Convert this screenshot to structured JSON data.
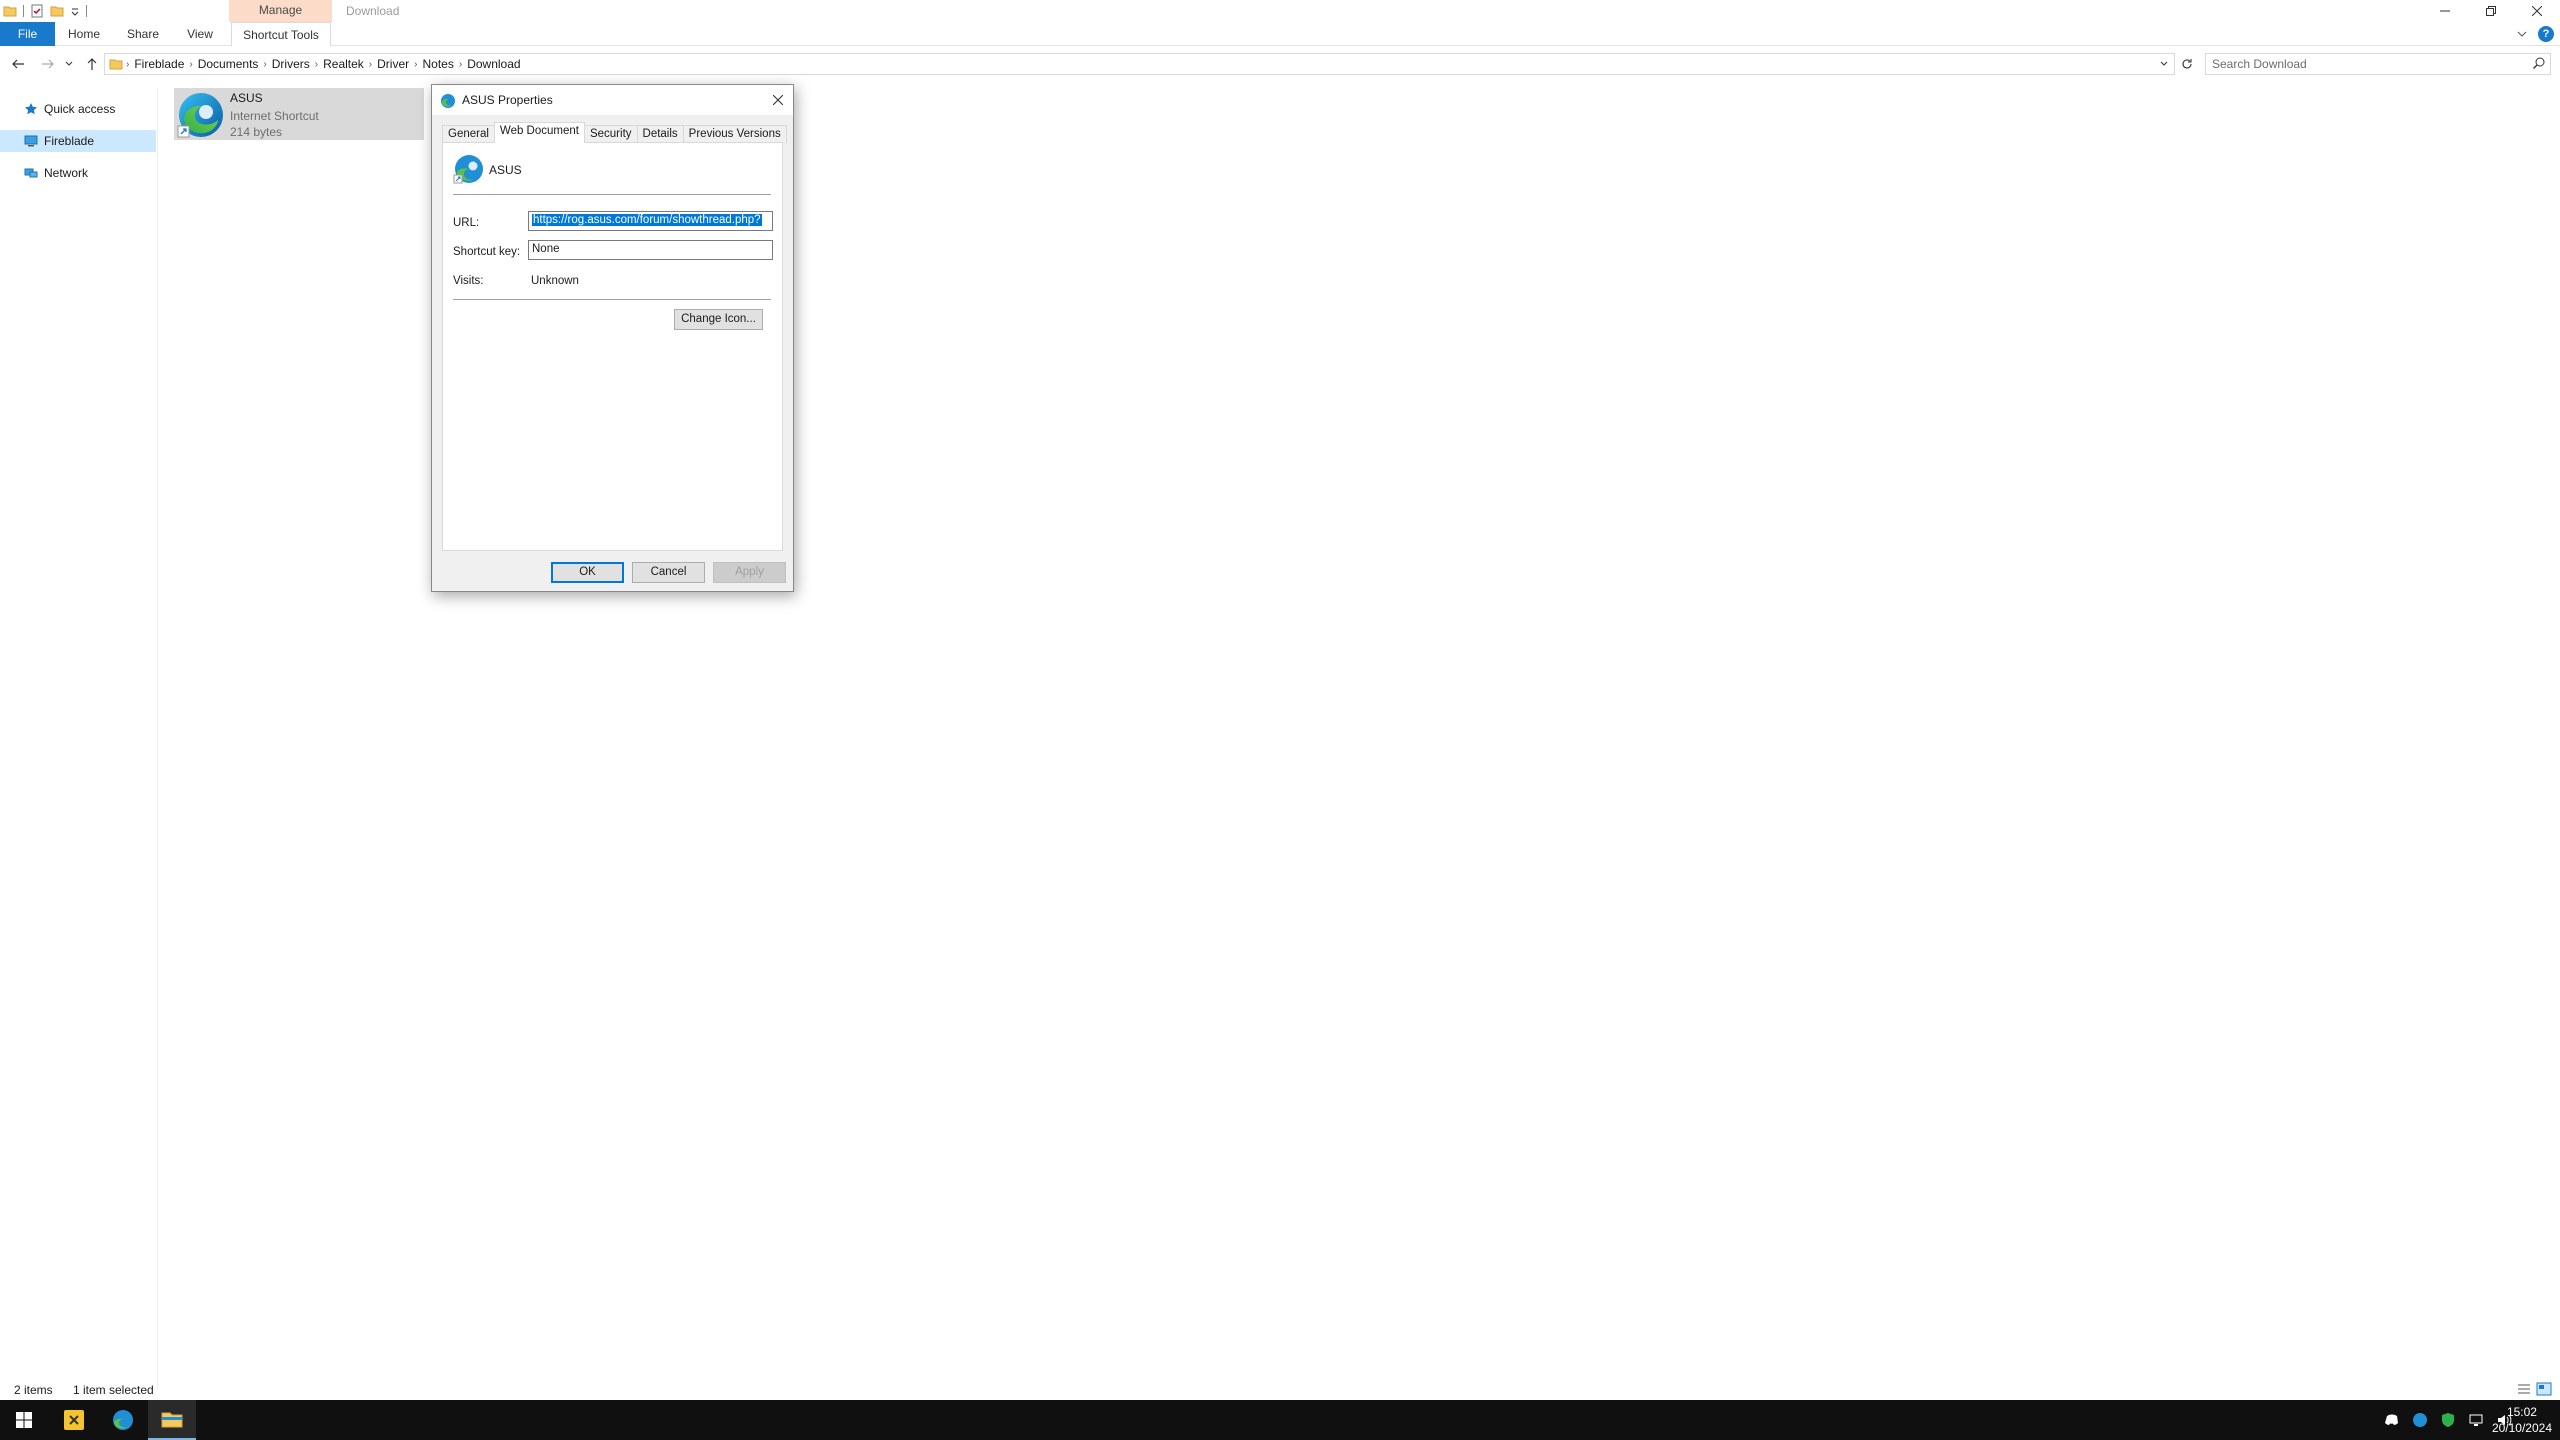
{
  "window": {
    "title": "Download",
    "context_tab_group": "Manage"
  },
  "ribbon": {
    "tabs": [
      "File",
      "Home",
      "Share",
      "View",
      "Shortcut Tools"
    ]
  },
  "address": {
    "crumbs": [
      "Fireblade",
      "Documents",
      "Drivers",
      "Realtek",
      "Driver",
      "Notes",
      "Download"
    ],
    "search_placeholder": "Search Download"
  },
  "nav_pane": {
    "items": [
      {
        "label": "Quick access",
        "icon": "star-icon"
      },
      {
        "label": "Fireblade",
        "icon": "computer-icon",
        "selected": true
      },
      {
        "label": "Network",
        "icon": "network-icon"
      }
    ]
  },
  "files": [
    {
      "name": "ASUS",
      "type": "Internet Shortcut",
      "size": "214 bytes",
      "selected": true
    }
  ],
  "status": {
    "count": "2 items",
    "selection": "1 item selected"
  },
  "dialog": {
    "title": "ASUS Properties",
    "tabs": [
      "General",
      "Web Document",
      "Security",
      "Details",
      "Previous Versions"
    ],
    "active_tab": "Web Document",
    "name": "ASUS",
    "url_label": "URL:",
    "url_value": "https://rog.asus.com/forum/showthread.php?",
    "shortcut_label": "Shortcut key:",
    "shortcut_value": "None",
    "visits_label": "Visits:",
    "visits_value": "Unknown",
    "change_icon_label": "Change Icon...",
    "ok_label": "OK",
    "cancel_label": "Cancel",
    "apply_label": "Apply"
  },
  "taskbar": {
    "time": "15:02",
    "date": "20/10/2024"
  },
  "colors": {
    "accent": "#1979ca",
    "selection": "#cce8ff",
    "manage_tab": "#fcdcc8",
    "taskbar": "#101010"
  }
}
